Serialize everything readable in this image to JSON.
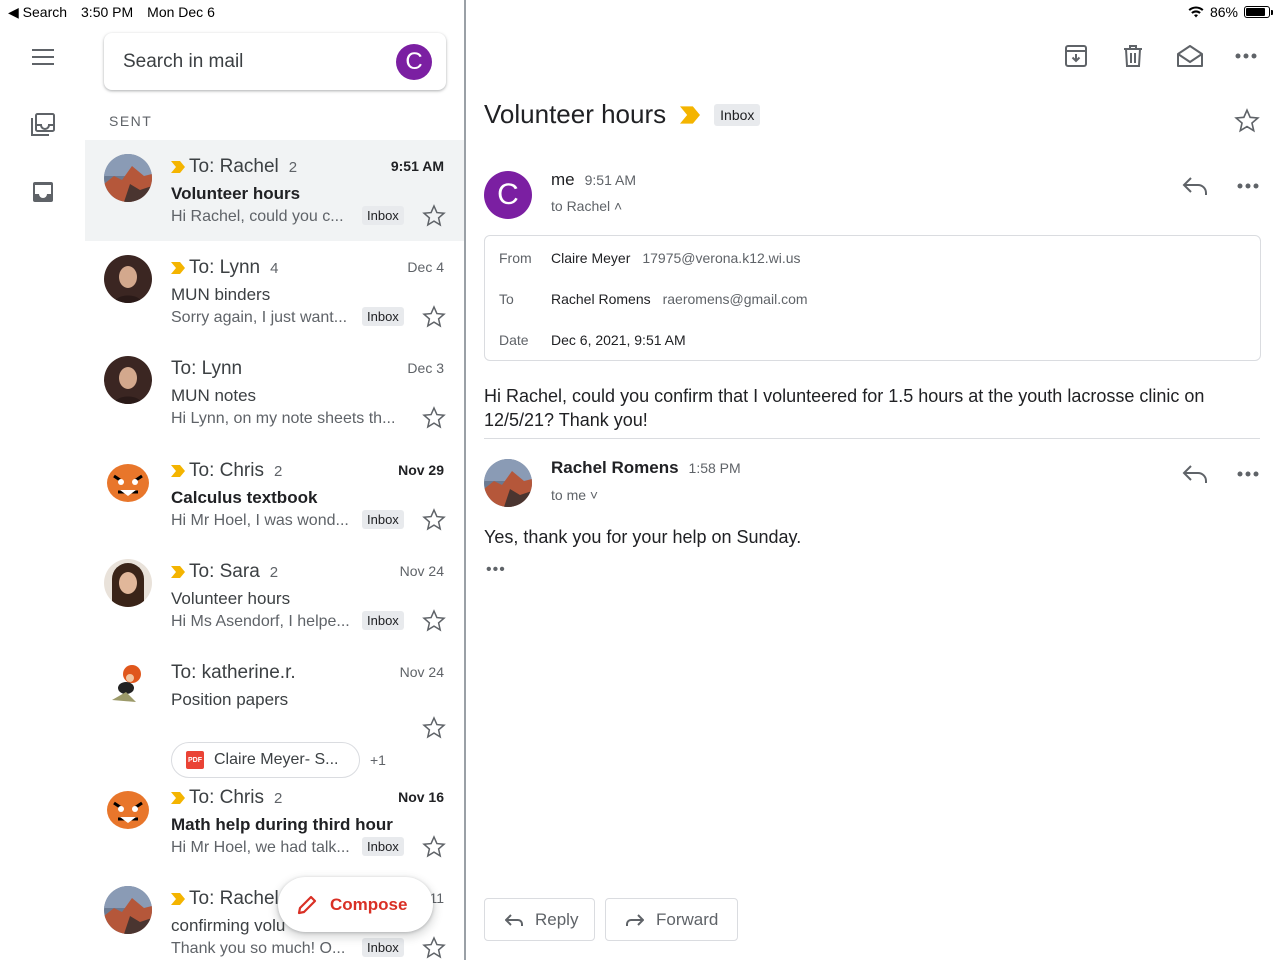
{
  "status_bar": {
    "back_label": "◀ Search",
    "time": "3:50 PM",
    "date": "Mon Dec 6",
    "battery": "86%",
    "battery_level": 0.86
  },
  "search": {
    "placeholder": "Search in mail",
    "avatar_letter": "C"
  },
  "list": {
    "section_label": "SENT",
    "rows": [
      {
        "to": "To: Rachel",
        "count": "2",
        "date": "9:51 AM",
        "subject": "Volunteer hours",
        "snippet": "Hi Rachel, could you c...",
        "label": "Inbox",
        "important": true,
        "bold": true
      },
      {
        "to": "To: Lynn",
        "count": "4",
        "date": "Dec 4",
        "subject": "MUN binders",
        "snippet": "Sorry again, I just want...",
        "label": "Inbox",
        "important": true,
        "bold": false
      },
      {
        "to": "To: Lynn",
        "count": "",
        "date": "Dec 3",
        "subject": "MUN notes",
        "snippet": "Hi Lynn, on my note sheets th...",
        "label": "",
        "important": false,
        "bold": false
      },
      {
        "to": "To: Chris",
        "count": "2",
        "date": "Nov 29",
        "subject": "Calculus textbook",
        "snippet": "Hi Mr Hoel, I was wond...",
        "label": "Inbox",
        "important": true,
        "bold": true
      },
      {
        "to": "To: Sara",
        "count": "2",
        "date": "Nov 24",
        "subject": "Volunteer hours",
        "snippet": "Hi Ms Asendorf, I helpe...",
        "label": "Inbox",
        "important": true,
        "bold": false
      },
      {
        "to": "To: katherine.r.",
        "count": "",
        "date": "Nov 24",
        "subject": "Position papers",
        "snippet": "",
        "label": "",
        "important": false,
        "bold": false,
        "attachment": "Claire Meyer- S...",
        "attachment_more": "+1"
      },
      {
        "to": "To: Chris",
        "count": "2",
        "date": "Nov 16",
        "subject": "Math help during third hour",
        "snippet": "Hi Mr Hoel, we had talk...",
        "label": "Inbox",
        "important": true,
        "bold": true
      },
      {
        "to": "To: Rachel",
        "count": "",
        "date": "11",
        "subject": "confirming volu",
        "snippet": "Thank you so much! O...",
        "label": "Inbox",
        "important": true,
        "bold": false
      }
    ]
  },
  "compose": {
    "label": "Compose"
  },
  "thread": {
    "subject": "Volunteer hours",
    "label": "Inbox",
    "message1": {
      "avatar_letter": "C",
      "sender": "me",
      "time": "9:51 AM",
      "recipients": "to Rachel ˄",
      "details": {
        "from_key": "From",
        "from_name": "Claire Meyer",
        "from_email": "17975@verona.k12.wi.us",
        "to_key": "To",
        "to_name": "Rachel Romens",
        "to_email": "raeromens@gmail.com",
        "date_key": "Date",
        "date_value": "Dec 6, 2021, 9:51 AM"
      },
      "body": "Hi Rachel, could you confirm that I volunteered for 1.5 hours at the youth lacrosse clinic on 12/5/21? Thank you!"
    },
    "message2": {
      "sender": "Rachel Romens",
      "time": "1:58 PM",
      "recipients": "to me ˅",
      "body": "Yes, thank you for your help on Sunday.",
      "trimmed": "•••"
    },
    "reply_label": "Reply",
    "forward_label": "Forward"
  },
  "colors": {
    "compose_red": "#d93025",
    "avatar_purple": "#7b1fa2",
    "important_yellow": "#f4b400",
    "selected_row": "#f1f3f4"
  }
}
